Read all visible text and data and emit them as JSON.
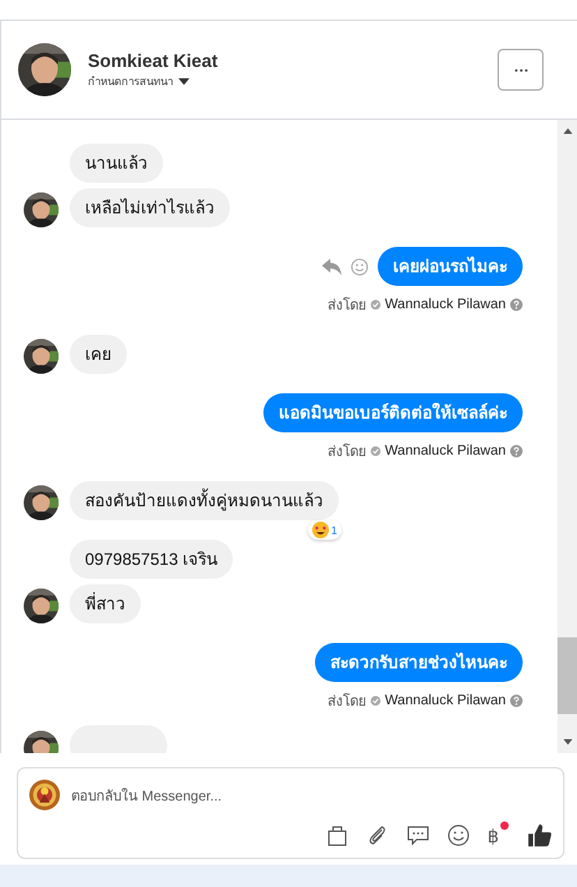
{
  "header": {
    "name": "Somkieat Kieat",
    "subtitle": "กำหนดการสนทนา"
  },
  "messages": [
    {
      "kind": "incoming",
      "bubbles": [
        "นานแล้ว",
        "เหลือไม่เท่าไรแล้ว"
      ]
    },
    {
      "kind": "outgoing",
      "text": "เคยผ่อนรถไมคะ",
      "show_actions": true,
      "sent_by": "ส่งโดย",
      "sender": "Wannaluck Pilawan"
    },
    {
      "kind": "incoming",
      "bubbles": [
        "เคย"
      ]
    },
    {
      "kind": "outgoing",
      "text": "แอดมินขอเบอร์ติดต่อให้เซลล์ค่ะ",
      "show_actions": false,
      "sent_by": "ส่งโดย",
      "sender": "Wannaluck Pilawan"
    },
    {
      "kind": "incoming",
      "bubbles": [
        "สองคันป้ายแดงทั้งคู่หมดนานแล้ว"
      ],
      "reaction_count": "1"
    },
    {
      "kind": "incoming",
      "bubbles": [
        "0979857513 เจริน",
        "พี่สาว"
      ]
    },
    {
      "kind": "outgoing",
      "text": "สะดวกรับสายช่วงไหนคะ",
      "show_actions": false,
      "sent_by": "ส่งโดย",
      "sender": "Wannaluck Pilawan"
    }
  ],
  "composer": {
    "placeholder": "ตอบกลับใน Messenger...",
    "payment_symbol": "฿",
    "payment_badge": true
  }
}
